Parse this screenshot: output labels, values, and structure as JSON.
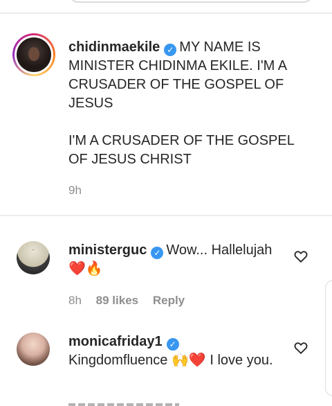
{
  "caption": {
    "username": "chidinmaekile",
    "text_line1_html": "MY NAME IS",
    "text_rest": "MINISTER CHIDINMA EKILE. I'M A CRUSADER OF THE GOSPEL OF JESUS",
    "text_paragraph2": "I'M A CRUSADER OF THE GOSPEL OF JESUS CHRIST",
    "time": "9h"
  },
  "comments": [
    {
      "username": "ministerguc",
      "text": "Wow... Hallelujah",
      "emoji": "❤️🔥",
      "time": "8h",
      "likes": "89 likes",
      "reply": "Reply"
    },
    {
      "username": "monicafriday1",
      "text": "Kingdomfluence 🙌❤️ I love you."
    }
  ],
  "icons": {
    "verified": "verified-badge-icon",
    "like": "heart-outline-icon"
  },
  "colors": {
    "verified": "#3897f0",
    "meta_text": "#8e8e8e",
    "text": "#262626"
  }
}
